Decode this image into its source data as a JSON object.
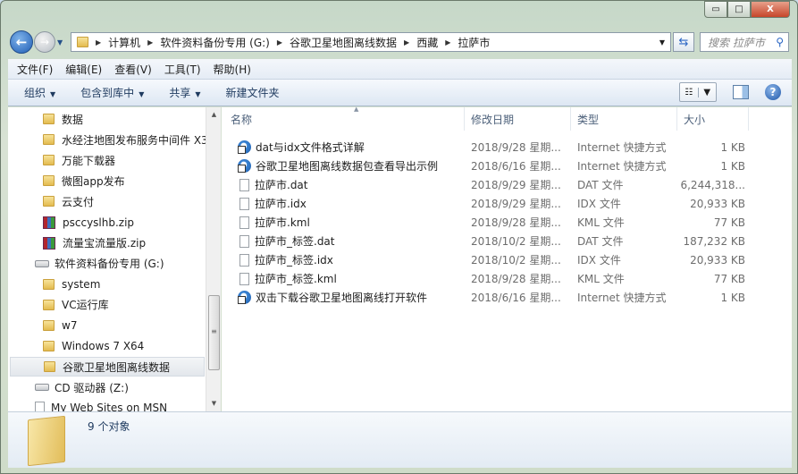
{
  "window": {
    "controls": {
      "minimize": "▭",
      "maximize": "□",
      "close": "X"
    }
  },
  "address": {
    "crumbs": [
      "计算机",
      "软件资料备份专用 (G:)",
      "谷歌卫星地图离线数据",
      "西藏",
      "拉萨市"
    ]
  },
  "search": {
    "placeholder": "搜索 拉萨市"
  },
  "menu": [
    "文件(F)",
    "编辑(E)",
    "查看(V)",
    "工具(T)",
    "帮助(H)"
  ],
  "toolbar": {
    "organize": "组织",
    "include": "包含到库中",
    "share": "共享",
    "new_folder": "新建文件夹"
  },
  "nav": [
    {
      "label": "数据",
      "icon": "folder"
    },
    {
      "label": "水经注地图发布服务中间件 X3",
      "icon": "folder"
    },
    {
      "label": "万能下载器",
      "icon": "folder"
    },
    {
      "label": "微图app发布",
      "icon": "folder"
    },
    {
      "label": "云支付",
      "icon": "folder"
    },
    {
      "label": "psccyslhb.zip",
      "icon": "zip"
    },
    {
      "label": "流量宝流量版.zip",
      "icon": "zip"
    },
    {
      "label": "软件资料备份专用 (G:)",
      "icon": "drive"
    },
    {
      "label": "system",
      "icon": "folder"
    },
    {
      "label": "VC运行库",
      "icon": "folder"
    },
    {
      "label": "w7",
      "icon": "folder"
    },
    {
      "label": "Windows 7 X64",
      "icon": "folder"
    },
    {
      "label": "谷歌卫星地图离线数据",
      "icon": "folder",
      "selected": true
    },
    {
      "label": "CD 驱动器 (Z:)",
      "icon": "cd-drive"
    },
    {
      "label": "My Web Sites on MSN",
      "icon": "document"
    }
  ],
  "columns": {
    "name": "名称",
    "date": "修改日期",
    "type": "类型",
    "size": "大小"
  },
  "files": [
    {
      "name": "dat与idx文件格式详解",
      "date": "2018/9/28 星期...",
      "type": "Internet 快捷方式",
      "size": "1 KB",
      "icon": "internet-shortcut"
    },
    {
      "name": "谷歌卫星地图离线数据包查看导出示例",
      "date": "2018/6/16 星期...",
      "type": "Internet 快捷方式",
      "size": "1 KB",
      "icon": "internet-shortcut"
    },
    {
      "name": "拉萨市.dat",
      "date": "2018/9/29 星期...",
      "type": "DAT 文件",
      "size": "6,244,318...",
      "icon": "file"
    },
    {
      "name": "拉萨市.idx",
      "date": "2018/9/29 星期...",
      "type": "IDX 文件",
      "size": "20,933 KB",
      "icon": "file"
    },
    {
      "name": "拉萨市.kml",
      "date": "2018/9/28 星期...",
      "type": "KML 文件",
      "size": "77 KB",
      "icon": "file"
    },
    {
      "name": "拉萨市_标签.dat",
      "date": "2018/10/2 星期...",
      "type": "DAT 文件",
      "size": "187,232 KB",
      "icon": "file"
    },
    {
      "name": "拉萨市_标签.idx",
      "date": "2018/10/2 星期...",
      "type": "IDX 文件",
      "size": "20,933 KB",
      "icon": "file"
    },
    {
      "name": "拉萨市_标签.kml",
      "date": "2018/9/28 星期...",
      "type": "KML 文件",
      "size": "77 KB",
      "icon": "file"
    },
    {
      "name": "双击下载谷歌卫星地图离线打开软件",
      "date": "2018/6/16 星期...",
      "type": "Internet 快捷方式",
      "size": "1 KB",
      "icon": "internet-shortcut"
    }
  ],
  "details": {
    "count": "9 个对象"
  }
}
